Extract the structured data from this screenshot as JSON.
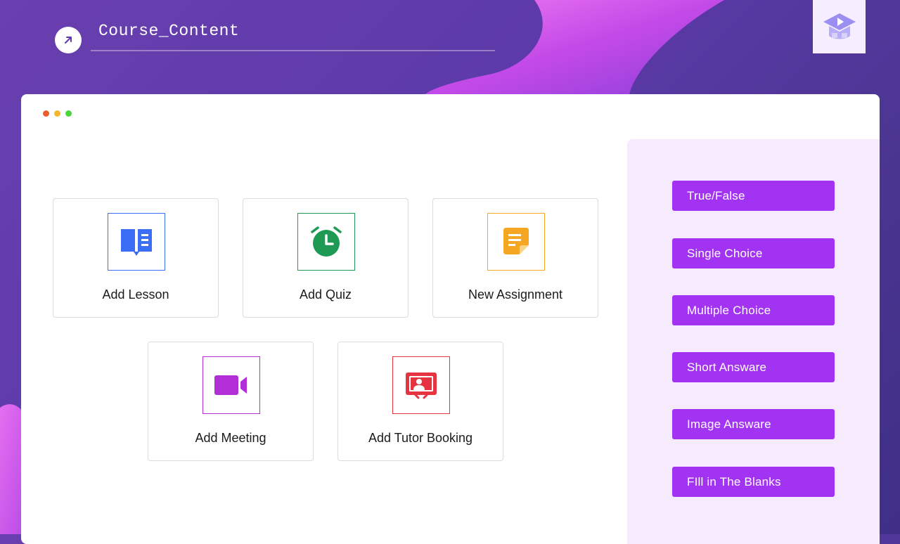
{
  "header": {
    "title": "Course_Content",
    "back_icon": "arrow-up-right-icon",
    "logo_icon": "graduation-cap-play-icon"
  },
  "window": {
    "dots": [
      "#ea5d2c",
      "#f4b62a",
      "#4cd43b"
    ]
  },
  "content_cards": [
    {
      "label": "Add Lesson",
      "icon": "book-icon",
      "color": "#3b6ef5"
    },
    {
      "label": "Add Quiz",
      "icon": "alarm-clock-icon",
      "color": "#1e9a55"
    },
    {
      "label": "New Assignment",
      "icon": "note-icon",
      "color": "#f5a623"
    },
    {
      "label": "Add Meeting",
      "icon": "video-camera-icon",
      "color": "#b22ed6"
    },
    {
      "label": "Add Tutor Booking",
      "icon": "presentation-icon",
      "color": "#e5343f"
    }
  ],
  "question_types": [
    {
      "label": "True/False"
    },
    {
      "label": "Single Choice"
    },
    {
      "label": "Multiple Choice"
    },
    {
      "label": "Short Answare"
    },
    {
      "label": "Image Answare"
    },
    {
      "label": "FIll in The Blanks"
    }
  ],
  "colors": {
    "accent": "#a333f2",
    "panel_bg": "#f6ebfd"
  }
}
